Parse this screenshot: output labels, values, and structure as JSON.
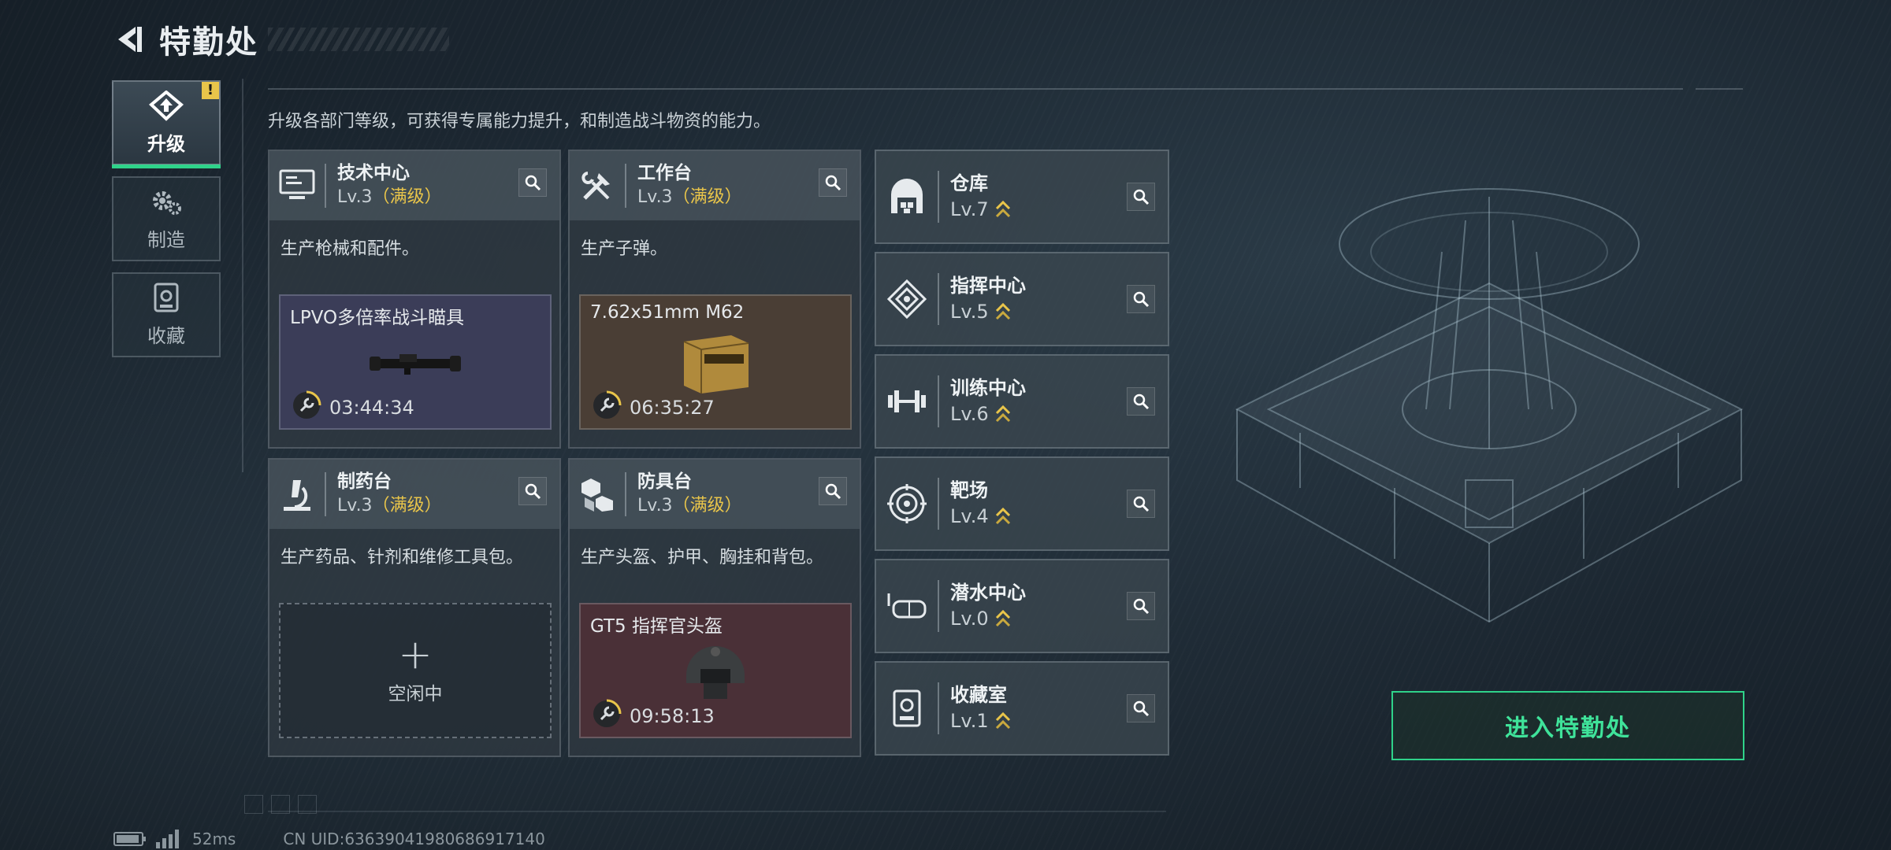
{
  "header": {
    "title": "特勤处",
    "back_icon": "back-arrow-icon"
  },
  "sidebar": {
    "items": [
      {
        "label": "升级",
        "icon": "upgrade-icon",
        "active": true,
        "badge": "!"
      },
      {
        "label": "制造",
        "icon": "gear-icon",
        "active": false
      },
      {
        "label": "收藏",
        "icon": "collection-icon",
        "active": false
      }
    ]
  },
  "description": "升级各部门等级，可获得专属能力提升，和制造战斗物资的能力。",
  "cards": [
    {
      "name": "技术中心",
      "level": "Lv.3",
      "max_label": "（满级）",
      "desc": "生产枪械和配件。",
      "slot": {
        "item": "LPVO多倍率战斗瞄具",
        "timer": "03:44:34",
        "color": "#3b3d58"
      }
    },
    {
      "name": "工作台",
      "level": "Lv.3",
      "max_label": "（满级）",
      "desc": "生产子弹。",
      "slot": {
        "item": "7.62x51mm M62",
        "timer": "06:35:27",
        "color": "#4a3e35"
      }
    },
    {
      "name": "制药台",
      "level": "Lv.3",
      "max_label": "（满级）",
      "desc": "生产药品、针剂和维修工具包。",
      "slot": {
        "plus": "+",
        "idle": "空闲中"
      }
    },
    {
      "name": "防具台",
      "level": "Lv.3",
      "max_label": "（满级）",
      "desc": "生产头盔、护甲、胸挂和背包。",
      "slot": {
        "item": "GT5 指挥官头盔",
        "timer": "09:58:13",
        "color": "#4a3037"
      }
    }
  ],
  "rooms": [
    {
      "name": "仓库",
      "level": "Lv.7",
      "icon": "warehouse-icon"
    },
    {
      "name": "指挥中心",
      "level": "Lv.5",
      "icon": "command-center-icon"
    },
    {
      "name": "训练中心",
      "level": "Lv.6",
      "icon": "dumbbell-icon"
    },
    {
      "name": "靶场",
      "level": "Lv.4",
      "icon": "target-icon"
    },
    {
      "name": "潜水中心",
      "level": "Lv.0",
      "icon": "diving-mask-icon"
    },
    {
      "name": "收藏室",
      "level": "Lv.1",
      "icon": "collection-icon"
    }
  ],
  "enter_button": "进入特勤处",
  "status": {
    "ping": "52ms",
    "uid": "CN UID:636390419806869171​40"
  },
  "colors": {
    "accent": "#2fd38a",
    "max_level": "#e9c54a",
    "alert": "#e9c54a"
  }
}
